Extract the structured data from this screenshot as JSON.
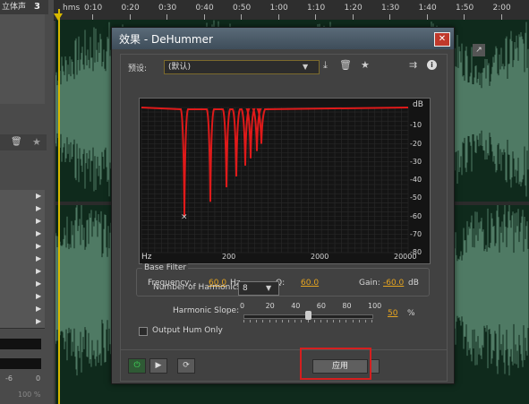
{
  "left_panel": {
    "header_text": "立体声",
    "header_number": "3",
    "bottom_values": [
      "-6",
      "0",
      "100 %"
    ]
  },
  "ruler": {
    "units_label": "hms",
    "ticks": [
      "0:10",
      "0:20",
      "0:30",
      "0:40",
      "0:50",
      "1:00",
      "1:10",
      "1:20",
      "1:30",
      "1:40",
      "1:50",
      "2:00"
    ]
  },
  "dialog": {
    "title": "效果 - DeHummer",
    "close_glyph": "✕",
    "preset_label": "预设:",
    "preset_value": "(默认)",
    "graph": {
      "db_unit": "dB",
      "db_ticks": [
        "-10",
        "-20",
        "-30",
        "-40",
        "-50",
        "-60",
        "-70",
        "-80"
      ],
      "hz_unit": "Hz",
      "freq_ticks": [
        "200",
        "2000",
        "20000"
      ]
    },
    "base_filter": {
      "legend": "Base Filter",
      "frequency_label": "Frequency:",
      "frequency_value": "60.0",
      "frequency_unit": "Hz",
      "q_label": "Q:",
      "q_value": "60.0",
      "gain_label": "Gain:",
      "gain_value": "-60.0",
      "gain_unit": "dB"
    },
    "harmonics": {
      "label": "Number of Harmonics:",
      "value": "8"
    },
    "slope": {
      "label": "Harmonic Slope:",
      "scale": [
        "0",
        "20",
        "40",
        "60",
        "80",
        "100"
      ],
      "value": "50",
      "unit": "%",
      "level_percent": 50
    },
    "output_hum_only_label": "Output Hum Only",
    "apply_label": "应用"
  },
  "colors": {
    "curve": "#e01a1a",
    "accent_value": "#e6a41f",
    "waveform": "#4f7a64",
    "highlight": "#d51f1f"
  },
  "icons": {
    "save_preset": "save-preset-icon",
    "delete_preset": "trash-icon",
    "favorite": "star-icon",
    "routing": "routing-icon",
    "info": "info-icon",
    "power": "power-icon",
    "play": "play-icon",
    "loop": "loop-icon"
  }
}
